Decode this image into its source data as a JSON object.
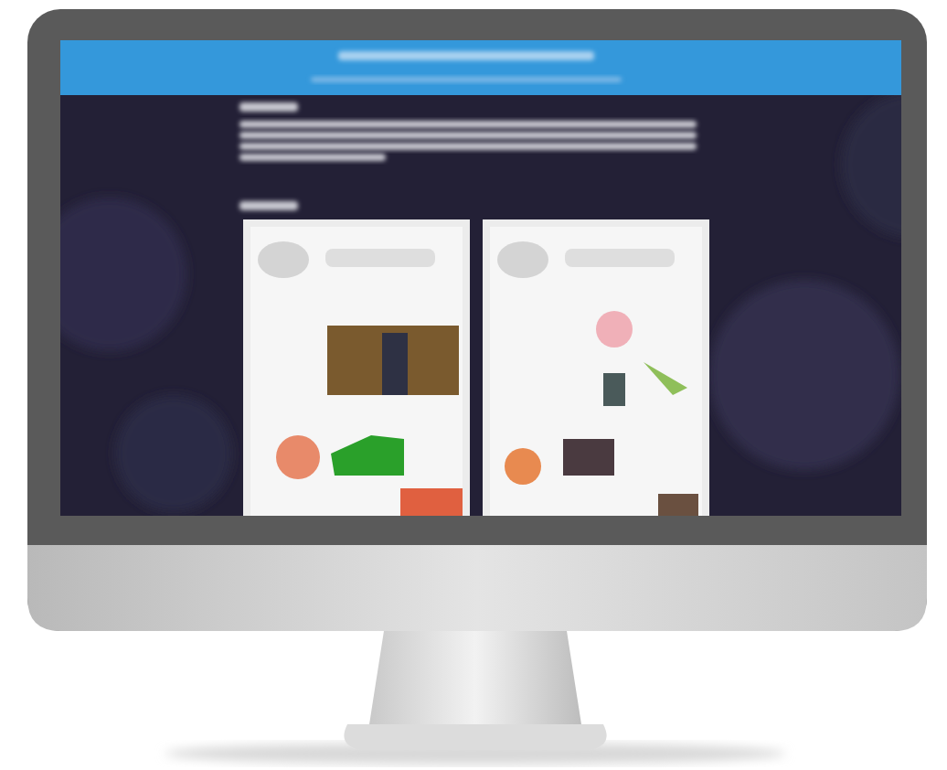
{
  "monitor": {
    "screen": {
      "header": {
        "lines": [
          {
            "kind": "title"
          },
          {
            "kind": "menu"
          }
        ]
      },
      "intro": {
        "lines": [
          {
            "kind": "heading"
          },
          {
            "kind": "paragraph"
          },
          {
            "kind": "paragraph"
          },
          {
            "kind": "paragraph"
          },
          {
            "kind": "paragraph_end"
          },
          {
            "kind": "heading"
          }
        ]
      }
    }
  }
}
